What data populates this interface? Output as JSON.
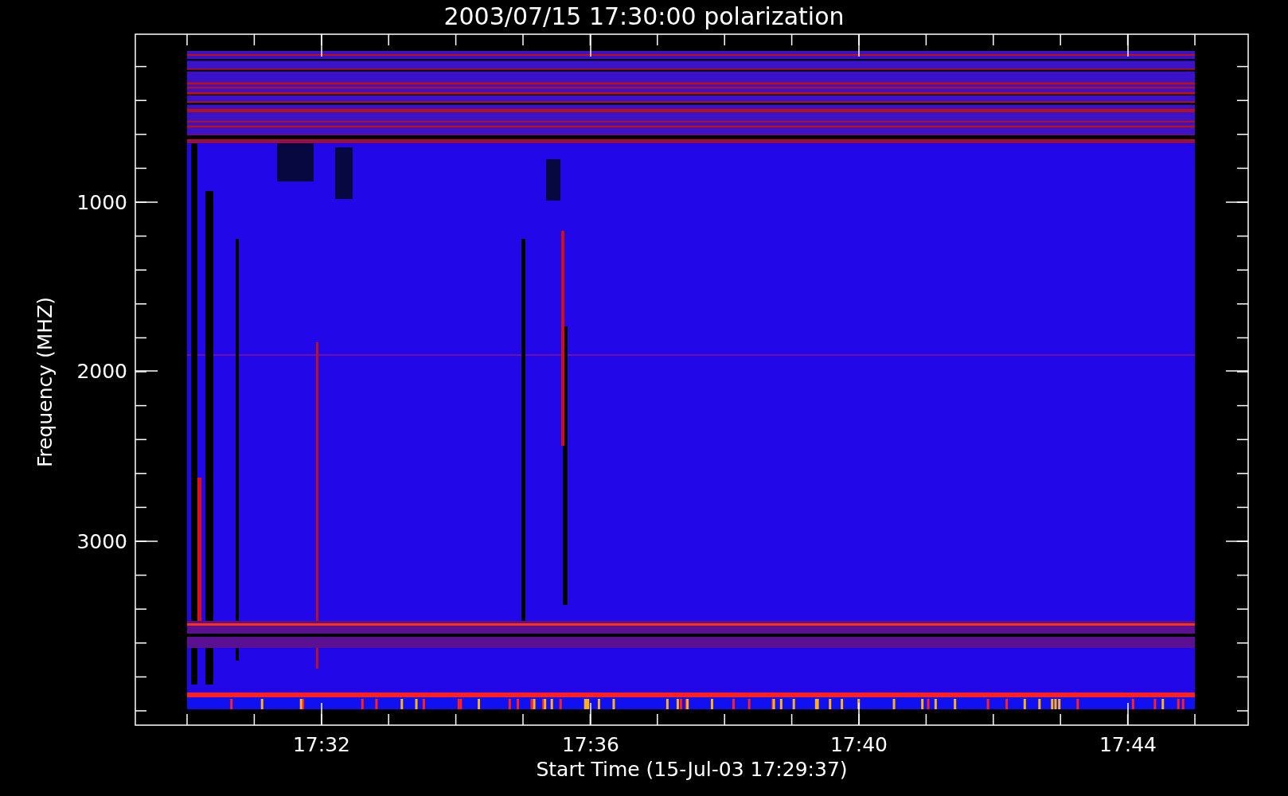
{
  "title": "2003/07/15 17:30:00 polarization",
  "x_axis": {
    "label": "Start Time (15-Jul-03 17:29:37)",
    "tick_labels": [
      "17:32",
      "17:36",
      "17:40",
      "17:44"
    ]
  },
  "y_axis": {
    "label": "Frequency (MHZ)",
    "tick_labels": [
      "1000",
      "2000",
      "3000"
    ]
  }
}
